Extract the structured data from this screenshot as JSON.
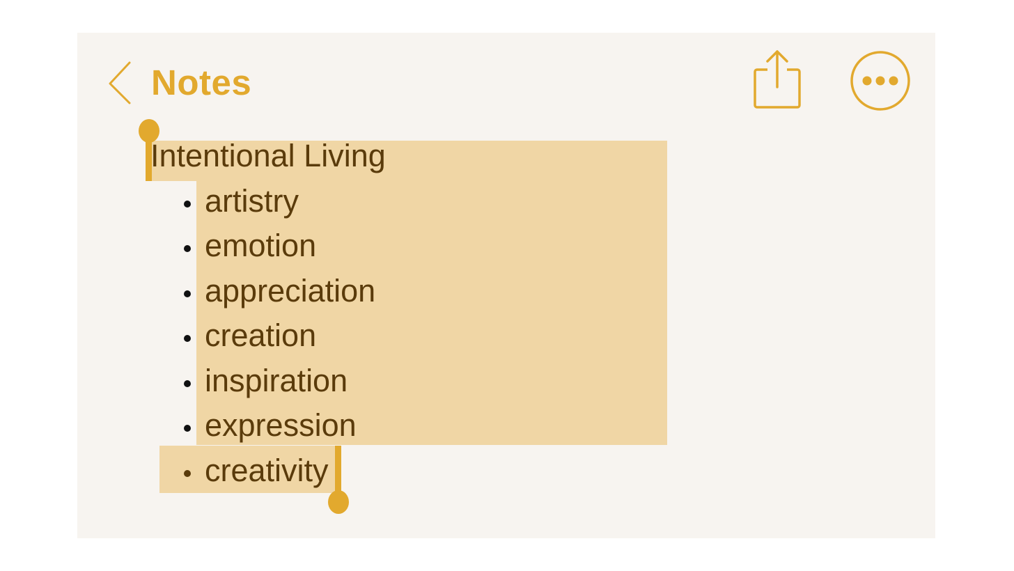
{
  "navigation": {
    "back_label": "Notes"
  },
  "toolbar": {
    "share_icon": "share-icon",
    "more_icon": "more-icon"
  },
  "note": {
    "title": "Intentional Living",
    "items": [
      "artistry",
      "emotion",
      "appreciation",
      "creation",
      "inspiration",
      "expression",
      "creativity"
    ]
  },
  "colors": {
    "accent": "#e2a92e",
    "selection": "#f0d6a5",
    "text": "#5a3b0b",
    "background": "#f7f4f0"
  }
}
